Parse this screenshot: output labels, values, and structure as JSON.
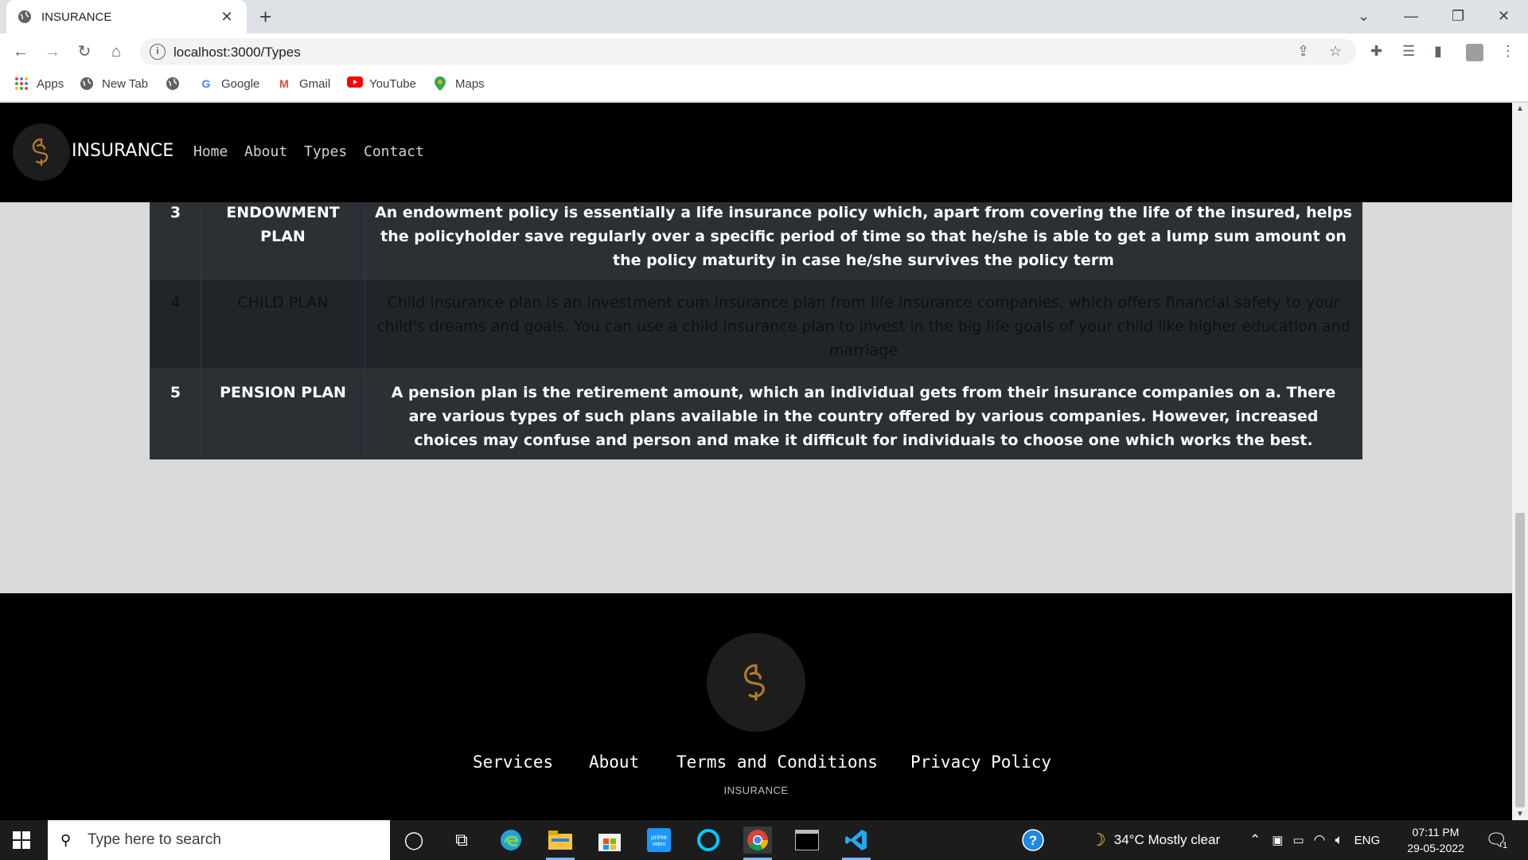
{
  "browser": {
    "tab_title": "INSURANCE",
    "url": "localhost:3000/Types",
    "bookmarks": [
      {
        "label": "Apps",
        "icon": "apps-grid-icon"
      },
      {
        "label": "New Tab",
        "icon": "globe-icon"
      },
      {
        "label": "",
        "icon": "globe-icon"
      },
      {
        "label": "Google",
        "icon": "google-icon"
      },
      {
        "label": "Gmail",
        "icon": "gmail-icon"
      },
      {
        "label": "YouTube",
        "icon": "youtube-icon"
      },
      {
        "label": "Maps",
        "icon": "maps-icon"
      }
    ]
  },
  "site": {
    "brand": "INSURANCE",
    "nav": [
      "Home",
      "About",
      "Types",
      "Contact"
    ],
    "accent_color": "#b07a2c"
  },
  "table": {
    "rows": [
      {
        "num": "3",
        "plan": "ENDOWMENT PLAN",
        "desc": "An endowment policy is essentially a life insurance policy which, apart from covering the life of the insured, helps the policyholder save regularly over a specific period of time so that he/she is able to get a lump sum amount on the policy maturity in case he/she survives the policy term"
      },
      {
        "num": "4",
        "plan": "CHILD PLAN",
        "desc": "Child insurance plan is an investment cum insurance plan from life insurance companies, which offers financial safety to your child's dreams and goals. You can use a child insurance plan to invest in the big life goals of your child like higher education and marriage"
      },
      {
        "num": "5",
        "plan": "PENSION PLAN",
        "desc": "A pension plan is the retirement amount, which an individual gets from their insurance companies on a. There are various types of such plans available in the country offered by various companies. However, increased choices may confuse and person and make it difficult for individuals to choose one which works the best."
      }
    ]
  },
  "footer": {
    "links": [
      "Services",
      "About",
      "Terms and Conditions",
      "Privacy Policy"
    ],
    "brand": "INSURANCE"
  },
  "taskbar": {
    "search_placeholder": "Type here to search",
    "weather": "34°C  Mostly clear",
    "language": "ENG",
    "time": "07:11 PM",
    "date": "29-05-2022",
    "notification_count": "1"
  }
}
